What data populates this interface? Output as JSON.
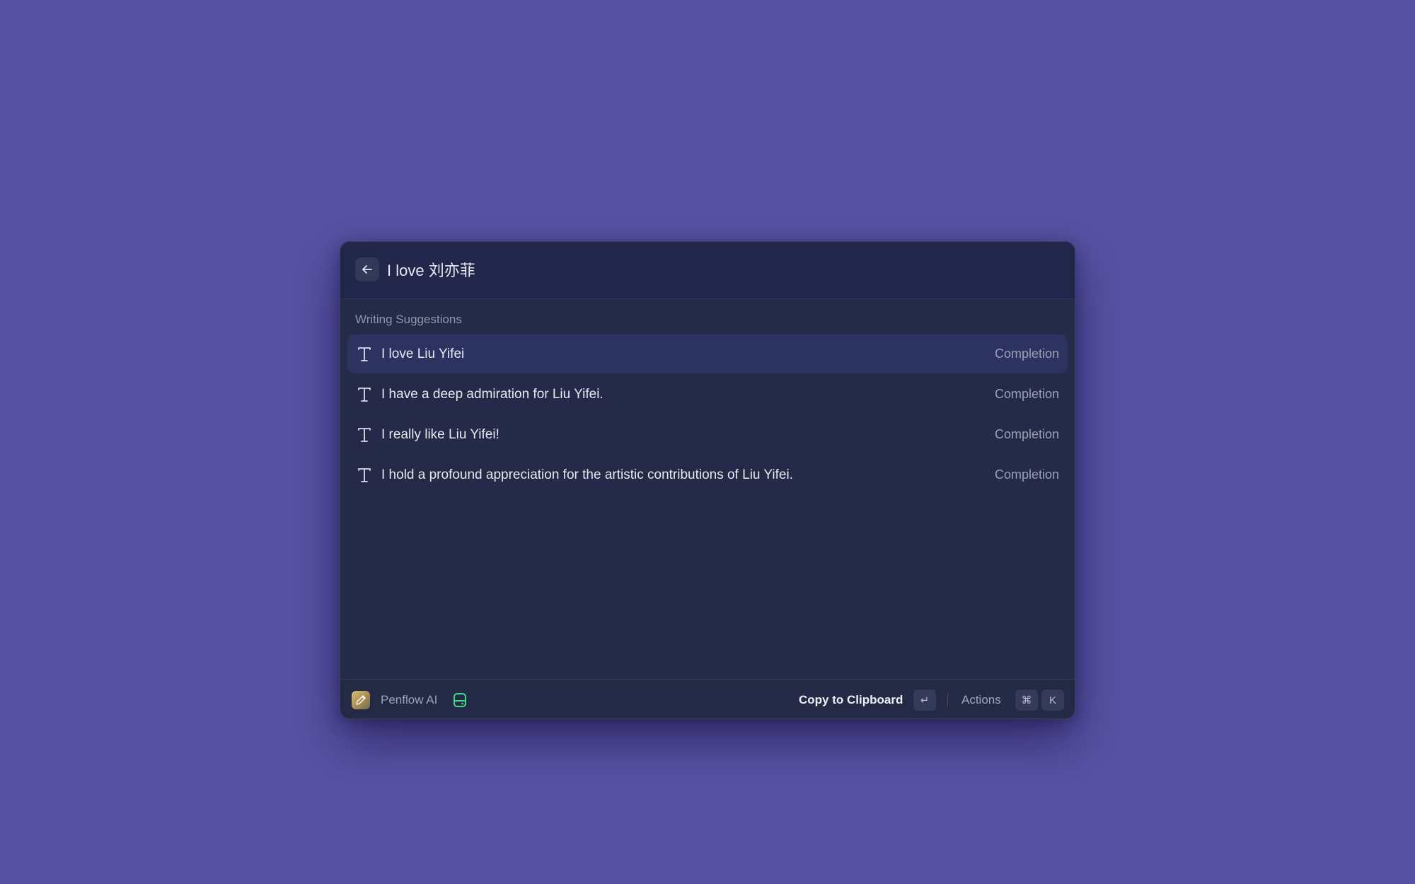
{
  "colors": {
    "desktop_background": "#5752a3",
    "window_background": "#242a47",
    "selected_row": "#2c3360",
    "status_icon": "#3ddc84"
  },
  "header": {
    "back_icon": "arrow-left-icon",
    "query": "I love 刘亦菲"
  },
  "section": {
    "title": "Writing Suggestions"
  },
  "suggestions": [
    {
      "icon": "text-icon",
      "text": "I love Liu Yifei",
      "kind": "Completion",
      "selected": true
    },
    {
      "icon": "text-icon",
      "text": "I have a deep admiration for Liu Yifei.",
      "kind": "Completion",
      "selected": false
    },
    {
      "icon": "text-icon",
      "text": "I really like Liu Yifei!",
      "kind": "Completion",
      "selected": false
    },
    {
      "icon": "text-icon",
      "text": "I hold a profound appreciation for the artistic contributions of Liu Yifei.",
      "kind": "Completion",
      "selected": false
    }
  ],
  "footer": {
    "app_icon": "pencil-icon",
    "app_name": "Penflow AI",
    "status_icon": "drive-icon",
    "primary_action": "Copy to Clipboard",
    "primary_shortcut": "↵",
    "actions_label": "Actions",
    "actions_shortcut": [
      "⌘",
      "K"
    ]
  }
}
